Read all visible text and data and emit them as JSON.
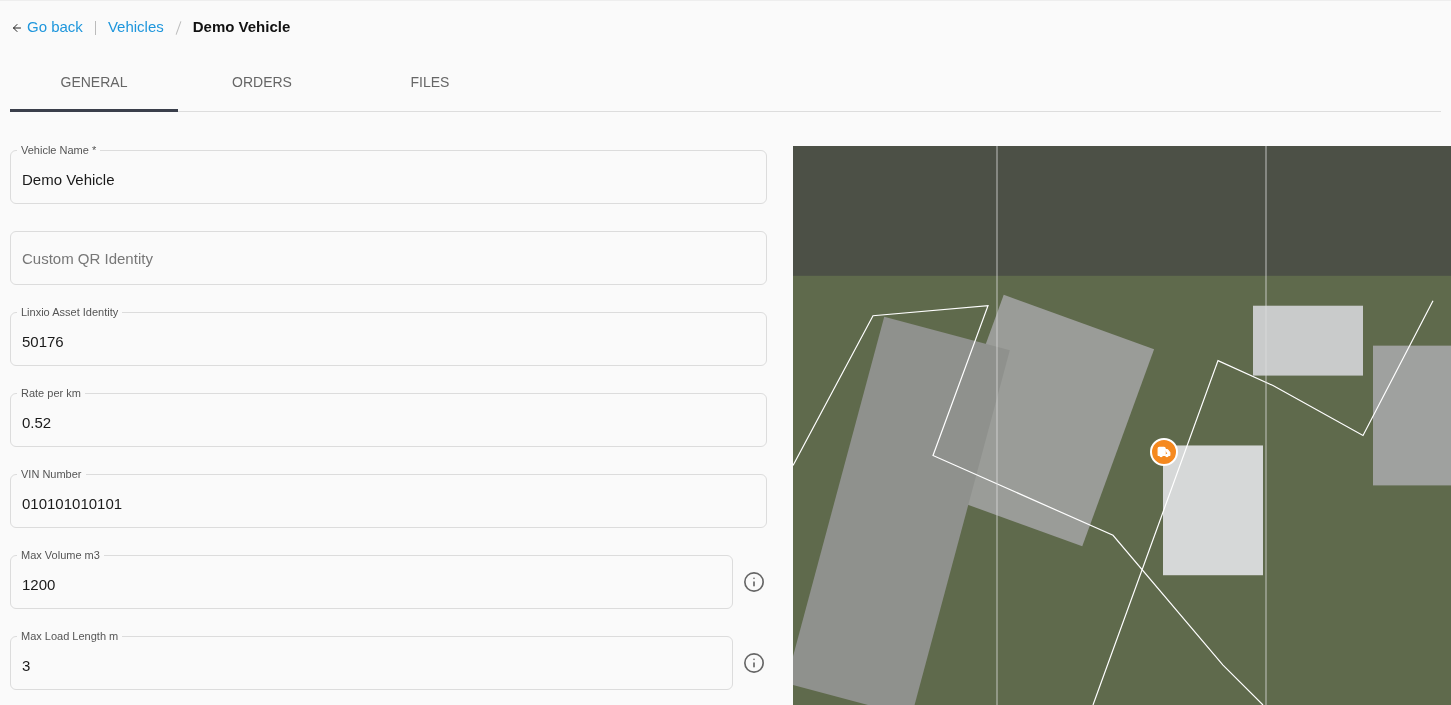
{
  "breadcrumb": {
    "back": "Go back",
    "parent": "Vehicles",
    "current": "Demo Vehicle"
  },
  "tabs": [
    {
      "label": "GENERAL",
      "selected": true
    },
    {
      "label": "ORDERS",
      "selected": false
    },
    {
      "label": "FILES",
      "selected": false
    }
  ],
  "fields": [
    {
      "label": "Vehicle Name *",
      "value": "Demo Vehicle",
      "info": false
    },
    {
      "placeholder": "Custom QR Identity",
      "info": false
    },
    {
      "label": "Linxio Asset Identity",
      "value": "50176",
      "info": false
    },
    {
      "label": "Rate per km",
      "value": "0.52",
      "info": false
    },
    {
      "label": "VIN Number",
      "value": "010101010101",
      "info": false
    },
    {
      "label": "Max Volume m3",
      "value": "1200",
      "info": true
    },
    {
      "label": "Max Load Length m",
      "value": "3",
      "info": true
    }
  ]
}
